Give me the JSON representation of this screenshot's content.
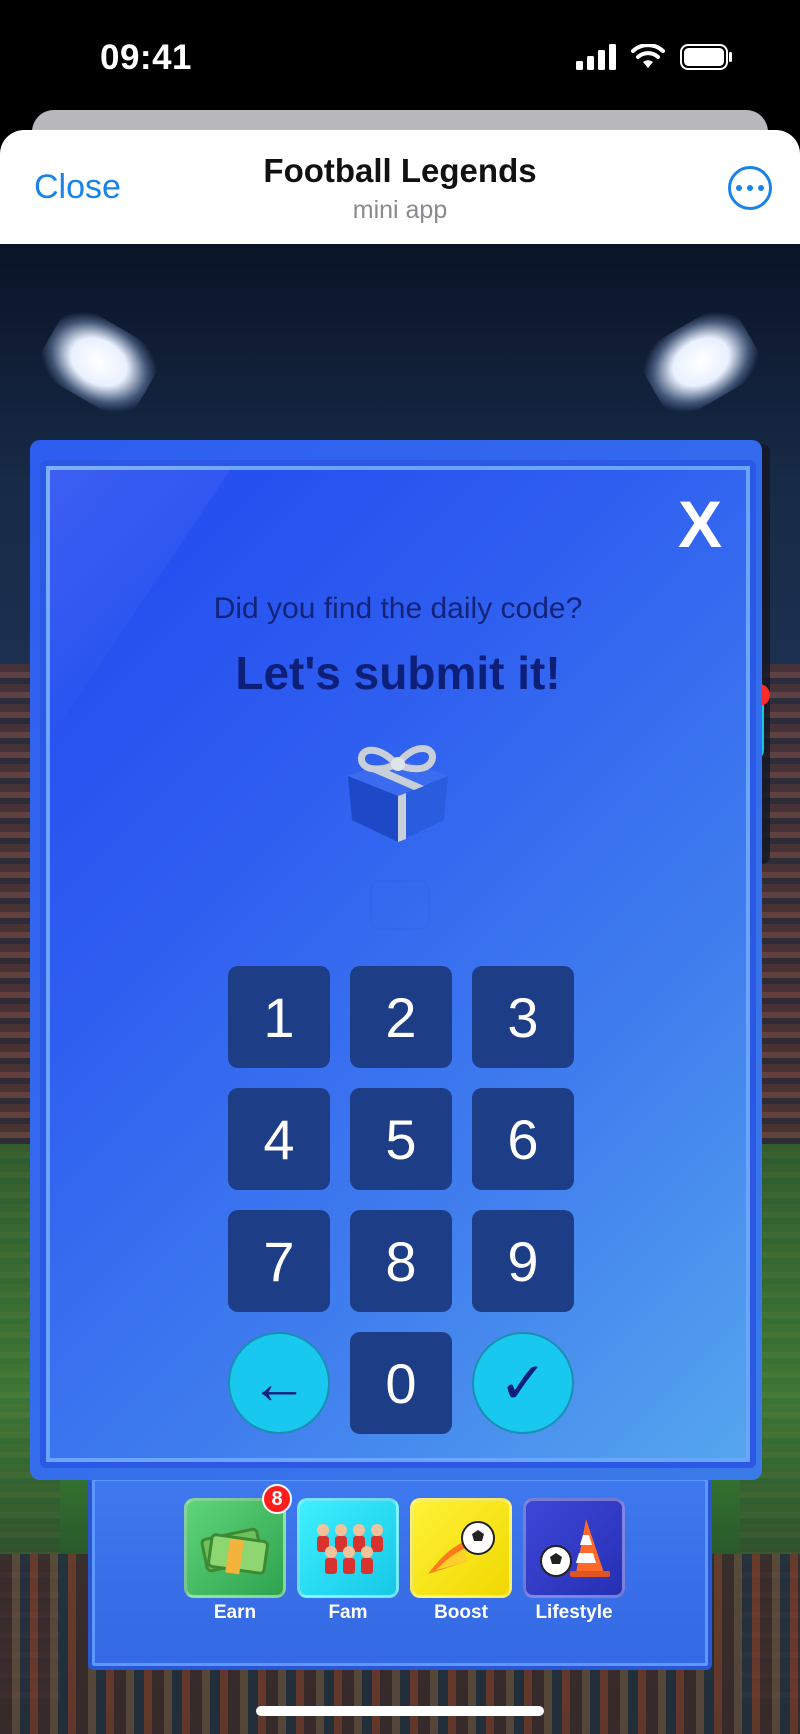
{
  "status_bar": {
    "time": "09:41"
  },
  "mini_app": {
    "close_label": "Close",
    "title": "Football Legends",
    "subtitle": "mini app"
  },
  "modal": {
    "close_label": "X",
    "prompt": "Did you find the daily code?",
    "headline": "Let's submit it!",
    "keys": [
      "1",
      "2",
      "3",
      "4",
      "5",
      "6",
      "7",
      "8",
      "9"
    ],
    "backspace": "←",
    "zero": "0",
    "submit": "✓"
  },
  "bottom_nav": {
    "items": [
      {
        "label": "Earn",
        "icon": "money-icon",
        "badge": "8"
      },
      {
        "label": "Fam",
        "icon": "team-icon"
      },
      {
        "label": "Boost",
        "icon": "fireball-icon"
      },
      {
        "label": "Lifestyle",
        "icon": "cone-ball-icon"
      }
    ]
  },
  "colors": {
    "modal_primary": "#2f5ff0",
    "key_bg": "#1d3d86",
    "action_key_bg": "#18c8ef",
    "link_blue": "#1a83e8"
  }
}
